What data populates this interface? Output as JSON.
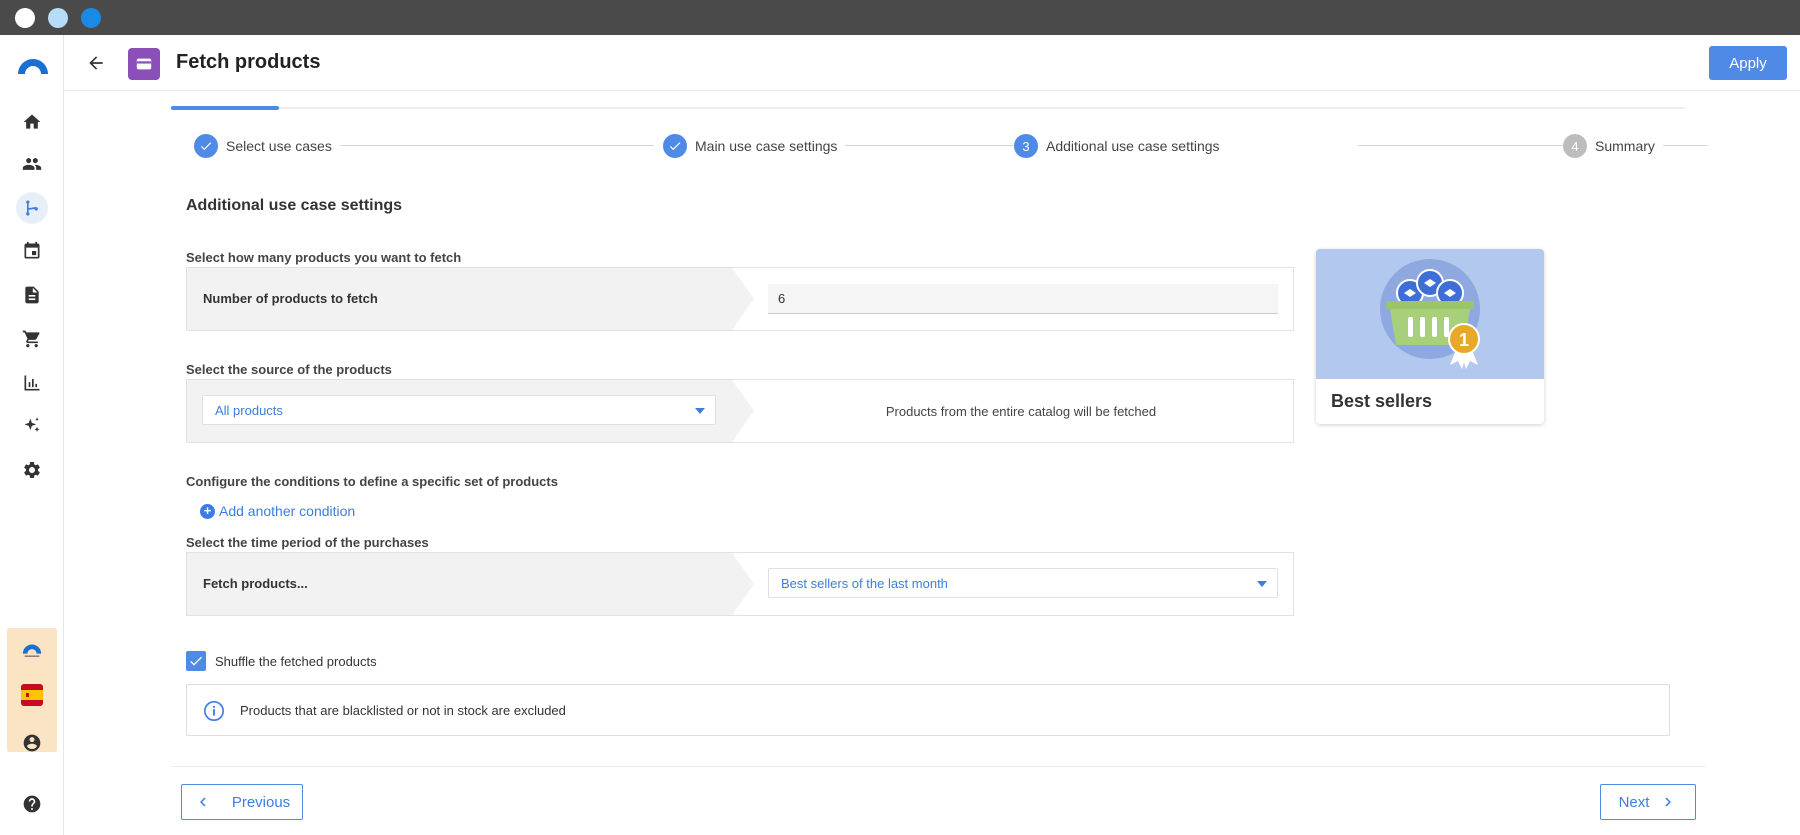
{
  "header": {
    "title": "Fetch products",
    "apply_label": "Apply"
  },
  "stepper": {
    "steps": [
      {
        "label": "Select use cases",
        "state": "done"
      },
      {
        "label": "Main use case settings",
        "state": "done"
      },
      {
        "label": "Additional use case settings",
        "state": "current",
        "number": "3"
      },
      {
        "label": "Summary",
        "state": "pending",
        "number": "4"
      }
    ]
  },
  "main": {
    "section_title": "Additional use case settings",
    "count": {
      "question": "Select how many products you want to fetch",
      "label": "Number of products to fetch",
      "value": "6"
    },
    "source": {
      "question": "Select the source of the products",
      "selected": "All products",
      "description": "Products from the entire catalog will be fetched"
    },
    "conditions": {
      "question": "Configure the conditions to define a specific set of products",
      "add_label": "Add another condition"
    },
    "period": {
      "question": "Select the time period of the purchases",
      "label": "Fetch products...",
      "selected": "Best sellers of the last month"
    },
    "shuffle": {
      "label": "Shuffle the fetched products",
      "checked": true
    },
    "info": "Products that are blacklisted or not in stock are excluded"
  },
  "card": {
    "title": "Best sellers",
    "badge": "1"
  },
  "footer": {
    "previous_label": "Previous",
    "next_label": "Next"
  },
  "colors": {
    "accent": "#4f8ae6",
    "app_icon": "#8a4fb8",
    "tenant_bg": "#fbe4c4"
  }
}
